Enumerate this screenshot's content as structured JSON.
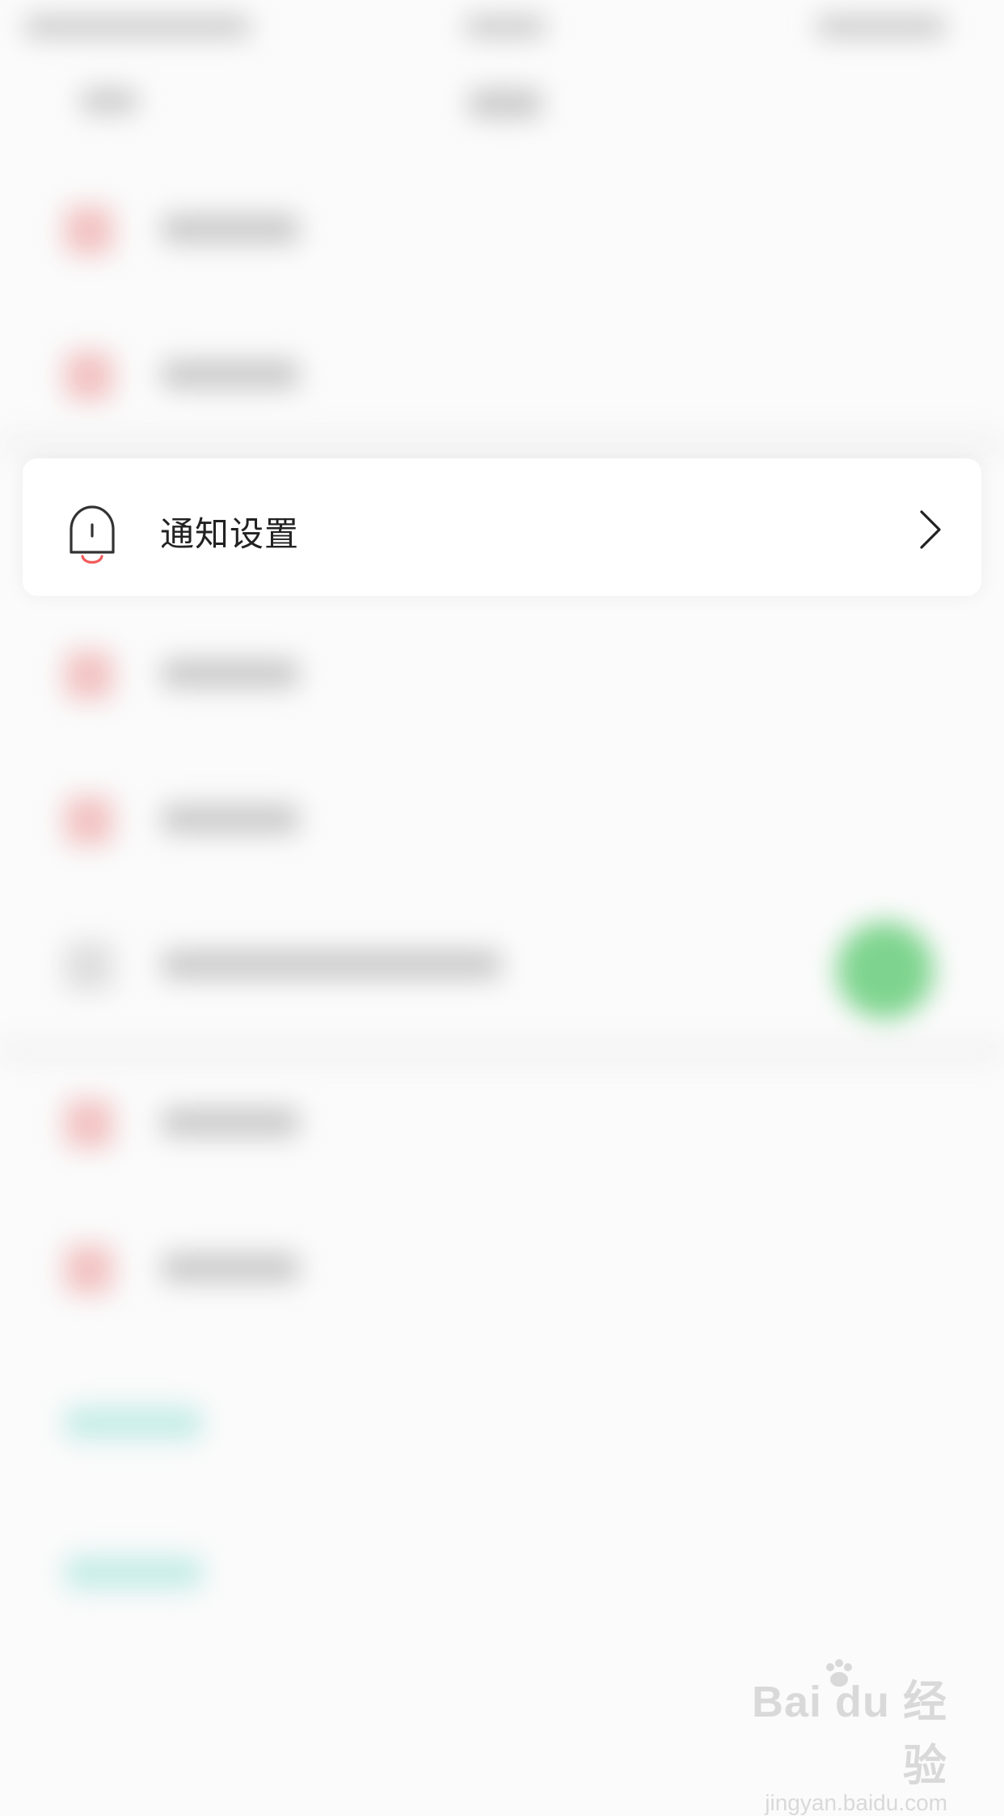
{
  "notification_row": {
    "label": "通知设置",
    "icon": "bell-icon",
    "chevron": "chevron-right-icon",
    "accent_color": "#f25b5b"
  },
  "watermark": {
    "logo_text": "Bai du 经验",
    "url_text": "jingyan.baidu.com"
  }
}
